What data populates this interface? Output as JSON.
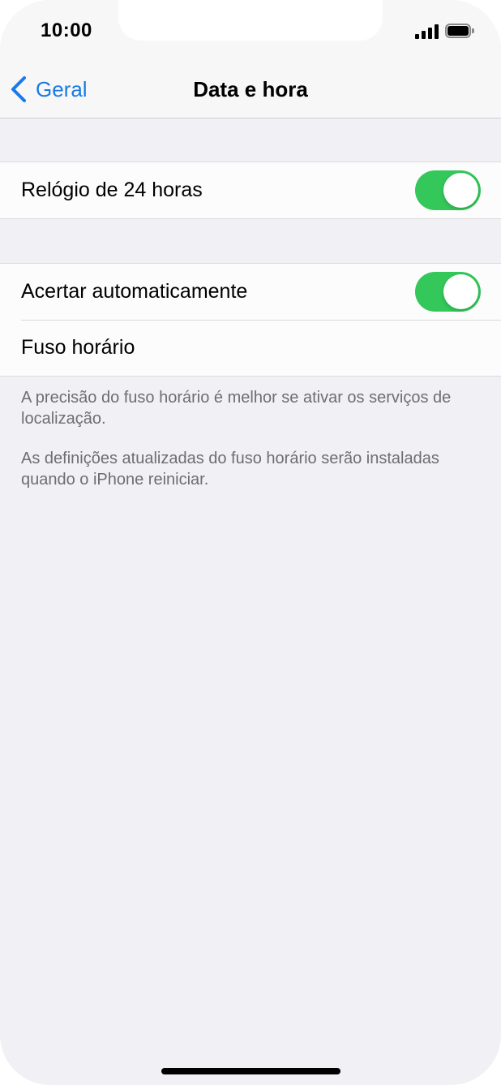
{
  "status_bar": {
    "time": "10:00"
  },
  "nav": {
    "back_label": "Geral",
    "title": "Data e hora"
  },
  "settings": {
    "clock_24h": {
      "label": "Relógio de 24 horas",
      "enabled": true
    },
    "auto_set": {
      "label": "Acertar automaticamente",
      "enabled": true
    },
    "time_zone": {
      "label": "Fuso horário"
    }
  },
  "footnotes": {
    "location_note": "A precisão do fuso horário é melhor se ativar os serviços de localização.",
    "update_note": "As definições atualizadas do fuso horário serão instaladas quando o iPhone reiniciar."
  },
  "colors": {
    "accent": "#1a7ae6",
    "toggle_on": "#34c759"
  },
  "icons": {
    "back": "chevron-left-icon",
    "signal": "cellular-signal-icon",
    "battery": "battery-icon"
  }
}
